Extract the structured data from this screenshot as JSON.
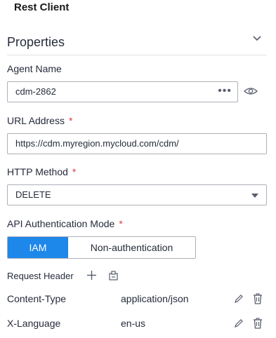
{
  "app": {
    "title": "Rest Client"
  },
  "properties": {
    "title": "Properties",
    "collapse_icon": "chevron-down-icon"
  },
  "agent": {
    "label": "Agent Name",
    "value": "cdm-2862",
    "more": "•••",
    "reveal_icon": "eye-icon"
  },
  "url": {
    "label": "URL Address",
    "required": "*",
    "value": "https://cdm.myregion.mycloud.com/cdm/"
  },
  "method": {
    "label": "HTTP Method",
    "required": "*",
    "value": "DELETE"
  },
  "auth": {
    "label": "API Authentication Mode",
    "required": "*",
    "options": [
      "IAM",
      "Non-authentication"
    ],
    "selected": "IAM",
    "accent_color": "#1e87ea"
  },
  "request_header": {
    "label": "Request Header",
    "add_icon": "plus-icon",
    "paste_icon": "paste-icon",
    "rows": [
      {
        "key": "Content-Type",
        "value": "application/json"
      },
      {
        "key": "X-Language",
        "value": "en-us"
      }
    ]
  }
}
